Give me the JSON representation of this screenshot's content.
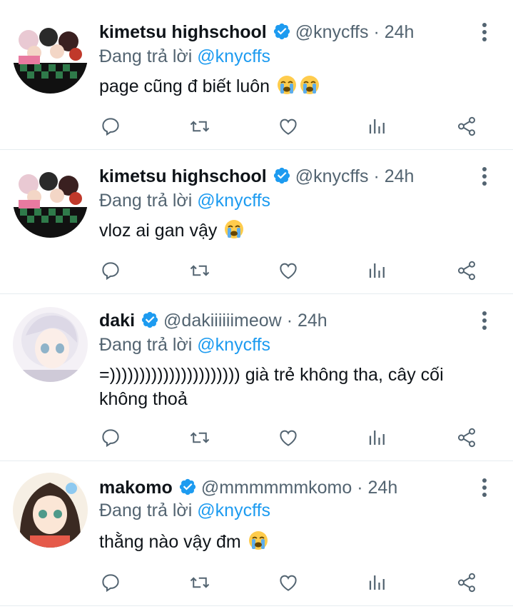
{
  "tweets": [
    {
      "name": "kimetsu highschool",
      "handle": "@knycffs",
      "separator": "·",
      "time": "24h",
      "replying_prefix": "Đang trả lời",
      "replying_to": "@knycffs",
      "text": "page cũng đ biết luôn",
      "emojis": [
        "loudly-crying-face-emoji",
        "loudly-crying-face-emoji"
      ],
      "avatar": "anime-group-avatar"
    },
    {
      "name": "kimetsu highschool",
      "handle": "@knycffs",
      "separator": "·",
      "time": "24h",
      "replying_prefix": "Đang trả lời",
      "replying_to": "@knycffs",
      "text": "vloz ai gan vậy",
      "emojis": [
        "loudly-crying-face-emoji"
      ],
      "avatar": "anime-group-avatar"
    },
    {
      "name": "daki",
      "handle": "@dakiiiiiimeow",
      "separator": "·",
      "time": "24h",
      "replying_prefix": "Đang trả lời",
      "replying_to": "@knycffs",
      "text": "=)))))))))))))))))))))) già trẻ không tha, cây cối không thoả",
      "emojis": [],
      "avatar": "white-hair-anime-avatar"
    },
    {
      "name": "makomo",
      "handle": "@mmmmmmkomo",
      "separator": "·",
      "time": "24h",
      "replying_prefix": "Đang trả lời",
      "replying_to": "@knycffs",
      "text": "thằng nào vậy đm",
      "emojis": [
        "loudly-crying-face-emoji"
      ],
      "avatar": "dark-hair-anime-avatar"
    }
  ],
  "actions": [
    "reply-icon",
    "retweet-icon",
    "like-icon",
    "analytics-icon",
    "share-icon"
  ],
  "colors": {
    "text": "#0f1419",
    "secondary": "#536471",
    "accent": "#1d9bf0",
    "divider": "#e6ecf0"
  }
}
